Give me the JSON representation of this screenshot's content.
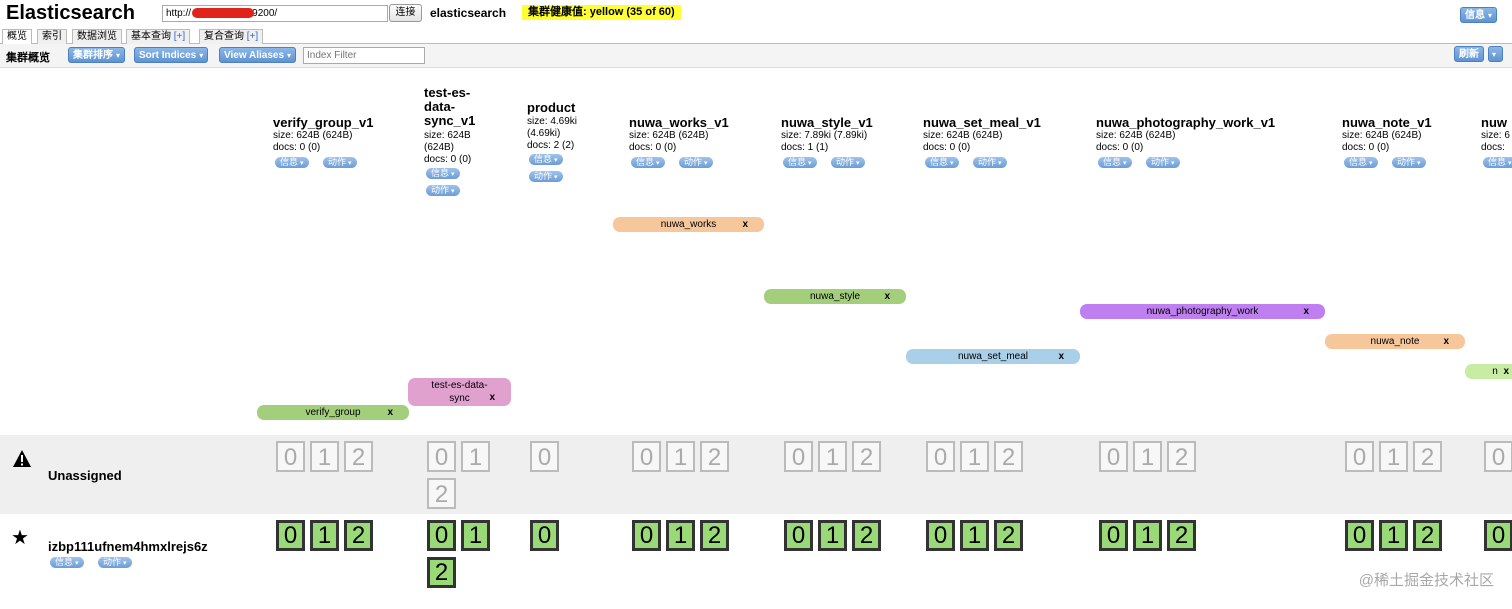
{
  "header": {
    "title": "Elasticsearch",
    "url": "http://                     :9200/",
    "connect_label": "连接",
    "cluster_name": "elasticsearch",
    "health": "集群健康值: yellow (35 of 60)",
    "info_label": "信息"
  },
  "tabs": [
    {
      "label": "概览",
      "plus": ""
    },
    {
      "label": "索引",
      "plus": ""
    },
    {
      "label": "数据浏览",
      "plus": ""
    },
    {
      "label": "基本查询 ",
      "plus": "[+]"
    },
    {
      "label": "复合查询 ",
      "plus": "[+]"
    }
  ],
  "toolbar": {
    "title": "集群概览",
    "sort_cluster": "集群排序",
    "sort_indices": "Sort Indices",
    "view_aliases": "View Aliases",
    "filter_placeholder": "Index Filter",
    "refresh": "刷新"
  },
  "index_buttons": {
    "info": "信息",
    "action": "动作"
  },
  "indices": [
    {
      "name": "verify_group_v1",
      "size": "size: 624B (624B)",
      "docs": "docs: 0 (0)",
      "alias": "verify_group",
      "alias_color": "#a3cf7d",
      "unassigned": [
        "0",
        "1",
        "2"
      ],
      "assigned": [
        "0",
        "1",
        "2"
      ]
    },
    {
      "name": "test-es-\ndata-\nsync_v1",
      "size": "size: 624B\n(624B)",
      "docs": "docs: 0 (0)",
      "alias": "test-es-data-\nsync",
      "alias_color": "#e1a1cf",
      "unassigned": [
        "0",
        "1",
        "2"
      ],
      "assigned": [
        "0",
        "1",
        "2"
      ]
    },
    {
      "name": "product",
      "size": "size: 4.69ki\n(4.69ki)",
      "docs": "docs: 2 (2)",
      "alias": "",
      "alias_color": "",
      "unassigned": [
        "0"
      ],
      "assigned": [
        "0"
      ]
    },
    {
      "name": "nuwa_works_v1",
      "size": "size: 624B (624B)",
      "docs": "docs: 0 (0)",
      "alias": "nuwa_works",
      "alias_color": "#f6c79b",
      "unassigned": [
        "0",
        "1",
        "2"
      ],
      "assigned": [
        "0",
        "1",
        "2"
      ]
    },
    {
      "name": "nuwa_style_v1",
      "size": "size: 7.89ki (7.89ki)",
      "docs": "docs: 1 (1)",
      "alias": "nuwa_style",
      "alias_color": "#a3cf7d",
      "unassigned": [
        "0",
        "1",
        "2"
      ],
      "assigned": [
        "0",
        "1",
        "2"
      ]
    },
    {
      "name": "nuwa_set_meal_v1",
      "size": "size: 624B (624B)",
      "docs": "docs: 0 (0)",
      "alias": "nuwa_set_meal",
      "alias_color": "#a9cfe9",
      "unassigned": [
        "0",
        "1",
        "2"
      ],
      "assigned": [
        "0",
        "1",
        "2"
      ]
    },
    {
      "name": "nuwa_photography_work_v1",
      "size": "size: 624B (624B)",
      "docs": "docs: 0 (0)",
      "alias": "nuwa_photography_work",
      "alias_color": "#c07ff0",
      "unassigned": [
        "0",
        "1",
        "2"
      ],
      "assigned": [
        "0",
        "1",
        "2"
      ]
    },
    {
      "name": "nuwa_note_v1",
      "size": "size: 624B (624B)",
      "docs": "docs: 0 (0)",
      "alias": "nuwa_note",
      "alias_color": "#f6c79b",
      "unassigned": [
        "0",
        "1",
        "2"
      ],
      "assigned": [
        "0",
        "1",
        "2"
      ]
    },
    {
      "name": "nuw",
      "size": "size: 6",
      "docs": "docs:",
      "alias": "n",
      "alias_color": "#c9eca5",
      "unassigned": [
        "0"
      ],
      "assigned": [
        "0"
      ]
    }
  ],
  "nodes": {
    "unassigned_label": "Unassigned",
    "node_name": "izbp111ufnem4hmxlrejs6z"
  },
  "watermark": "@稀土掘金技术社区"
}
